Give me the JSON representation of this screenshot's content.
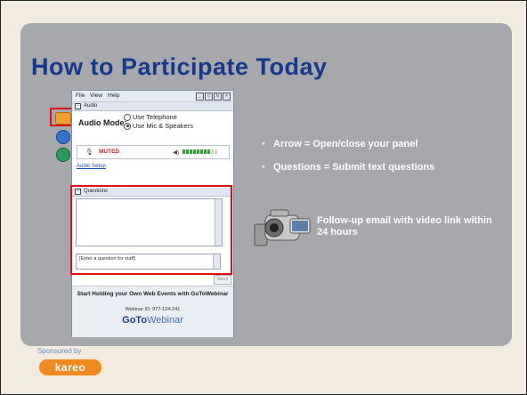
{
  "slide": {
    "title": "How to Participate Today",
    "bullets": [
      "Arrow = Open/close your panel",
      "Questions = Submit text questions"
    ],
    "followup": "Follow-up email with video link within 24 hours",
    "sponsored_by": "Sponsored by",
    "sponsor_logo": "kareo"
  },
  "webinar_panel": {
    "menu": [
      "File",
      "View",
      "Help"
    ],
    "audio_section": "Audio",
    "audio_mode_label": "Audio Mode:",
    "audio_options": [
      {
        "label": "Use Telephone",
        "selected": false
      },
      {
        "label": "Use Mic & Speakers",
        "selected": true
      }
    ],
    "mic_status": "MUTED",
    "speaker_level": 0.8,
    "audio_setup_link": "Audio Setup",
    "questions_section": "Questions",
    "question_placeholder": "[Enter a question for staff]",
    "send_button": "Send",
    "promo_line1": "Start Holding your Own Web Events with GoToWebinar",
    "webinar_id": "Webinar ID: 977-124-241",
    "logo_bold": "GoTo",
    "logo_light": "Webinar"
  },
  "colors": {
    "title": "#153a8b",
    "panel": "#a6a8ab",
    "slide_bg": "#f1ebe0",
    "highlight": "#dd1111",
    "muted": "#d21d1d",
    "sponsor": "#ef8a1f"
  }
}
